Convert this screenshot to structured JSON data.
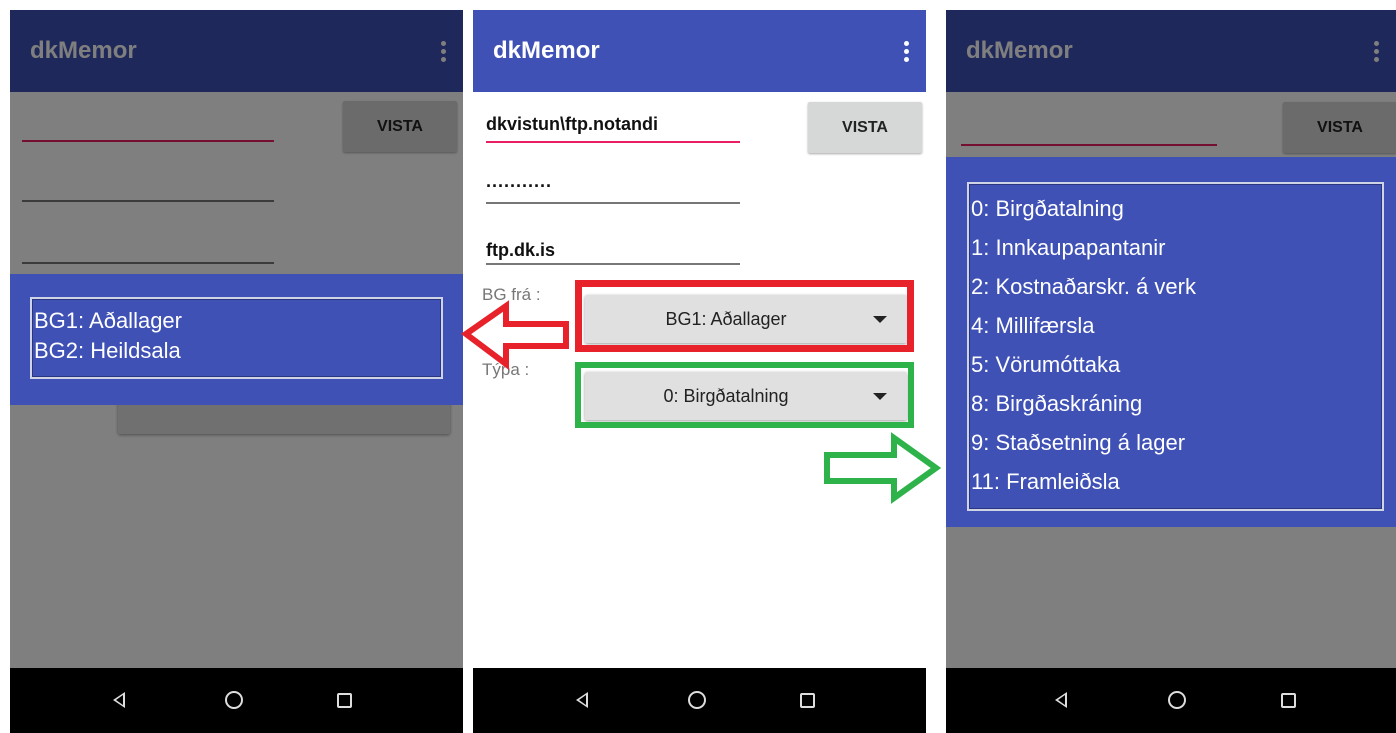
{
  "app": {
    "title": "dkMemor"
  },
  "form": {
    "username": "dkvistun\\ftp.notandi",
    "password": "···········",
    "server": "ftp.dk.is",
    "save_button": "VISTA",
    "warehouse_label": "BG frá :",
    "warehouse_value": "BG1: Aðallager",
    "type_label": "Týpa :",
    "type_value": "0: Birgðatalning"
  },
  "warehouse_options": [
    "BG1: Aðallager",
    "BG2: Heildsala"
  ],
  "type_options": [
    "0: Birgðatalning",
    "1: Innkaupapantanir",
    "2: Kostnaðarskr. á verk",
    "4: Millifærsla",
    "5: Vörumóttaka",
    "8: Birgðaskráning",
    "9: Staðsetning á lager",
    "11: Framleiðsla"
  ],
  "colors": {
    "app_bar": "#3f51b5",
    "highlight_warehouse": "#e8222a",
    "highlight_type": "#2db34a",
    "accent_line": "#e91e63"
  },
  "icons": {
    "overflow_menu": "more-vert-icon",
    "nav": [
      "nav-back-icon",
      "nav-home-icon",
      "nav-recent-icon"
    ],
    "spinner": "caret-down-icon",
    "annotations": [
      "arrow-left-icon",
      "arrow-right-icon"
    ]
  }
}
